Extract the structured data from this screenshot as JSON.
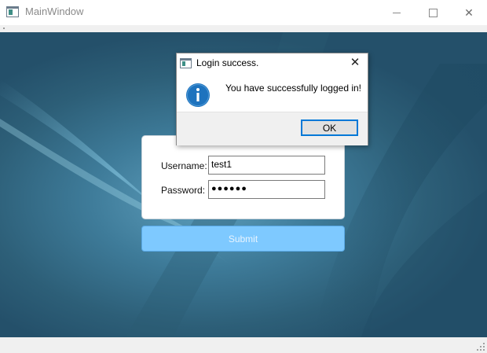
{
  "window": {
    "title": "MainWindow",
    "minimize_icon": "minimize-icon",
    "maximize_icon": "maximize-icon",
    "close_glyph": "✕"
  },
  "login_form": {
    "username_label": "Username:",
    "username_value": "test1",
    "password_label": "Password:",
    "password_value": "●●●●●●",
    "submit_label": "Submit"
  },
  "dialog": {
    "title": "Login success.",
    "message": "You have successfully logged in!",
    "ok_label": "OK",
    "close_glyph": "✕",
    "icon": "information-icon"
  },
  "colors": {
    "submit_bg": "#7ec9ff",
    "info_icon": "#1e73be",
    "ok_focus_border": "#0078d7"
  }
}
